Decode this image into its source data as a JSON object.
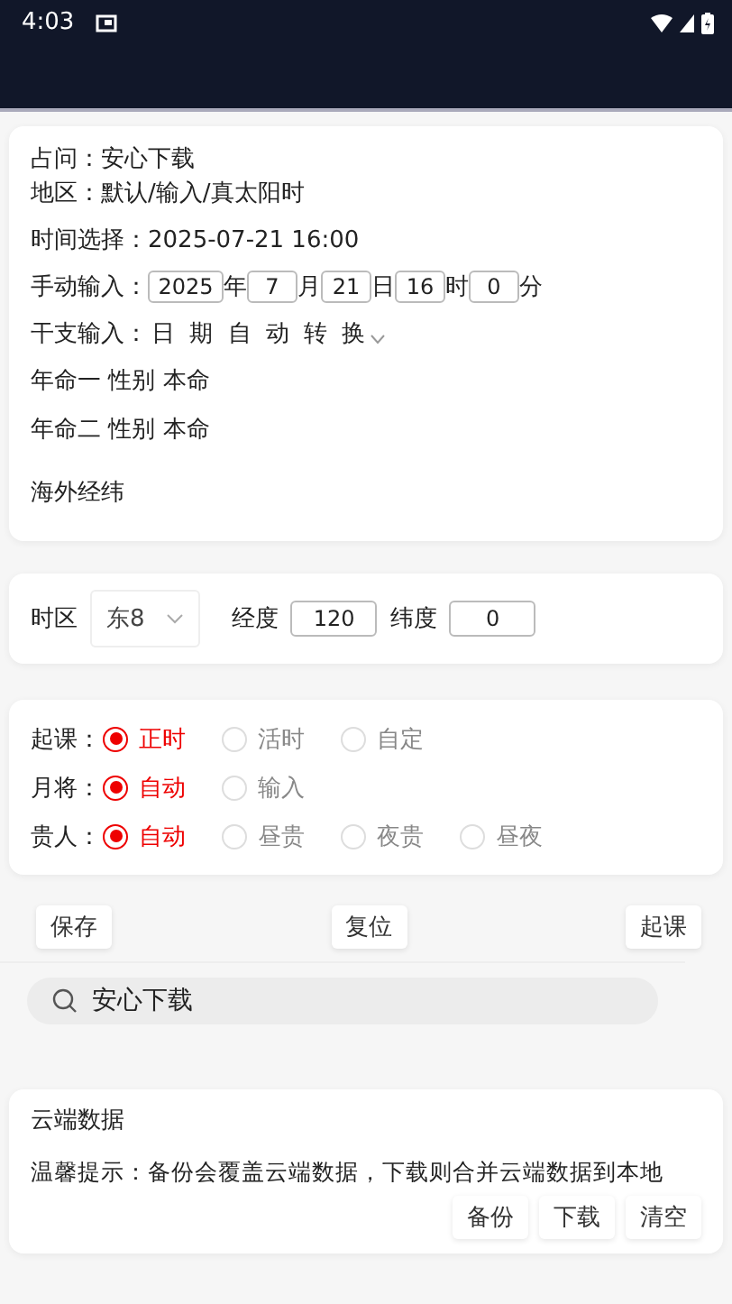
{
  "status_bar": {
    "time": "4:03"
  },
  "info": {
    "rows": [
      {
        "label": "占问：",
        "value": "安心下载"
      },
      {
        "label": "地区：",
        "value": "默认/输入/真太阳时"
      },
      {
        "label": "时间选择：",
        "value": "2025-07-21 16:00"
      }
    ],
    "manual": {
      "label": "手动输入：",
      "fields": [
        {
          "value": "2025",
          "unit": "年"
        },
        {
          "value": "7",
          "unit": "月"
        },
        {
          "value": "21",
          "unit": "日"
        },
        {
          "value": "16",
          "unit": "时"
        },
        {
          "value": "0",
          "unit": "分"
        }
      ]
    },
    "ganzhi": {
      "label": "干支输入：",
      "value": "日 期 自 动 转 换"
    },
    "extra": [
      "年命一 性别 本命",
      "年命二 性别 本命",
      "海外经纬"
    ]
  },
  "location": {
    "timezone_label": "时区",
    "timezone": "东8",
    "longitude_label": "经度",
    "longitude": "120",
    "latitude_label": "纬度",
    "latitude": "0"
  },
  "options": [
    {
      "label": "起课：",
      "choices": [
        {
          "label": "正时",
          "selected": true
        },
        {
          "label": "活时",
          "selected": false
        },
        {
          "label": "自定",
          "selected": false
        }
      ]
    },
    {
      "label": "月将：",
      "choices": [
        {
          "label": "自动",
          "selected": true
        },
        {
          "label": "输入",
          "selected": false
        }
      ]
    },
    {
      "label": "贵人：",
      "choices": [
        {
          "label": "自动",
          "selected": true
        },
        {
          "label": "昼贵",
          "selected": false
        },
        {
          "label": "夜贵",
          "selected": false
        },
        {
          "label": "昼夜",
          "selected": false
        }
      ]
    }
  ],
  "actions": [
    "保存",
    "复位",
    "起课"
  ],
  "search": {
    "value": "安心下载"
  },
  "cloud": {
    "title": "云端数据",
    "tip": "温馨提示：备份会覆盖云端数据，下载则合并云端数据到本地",
    "buttons": [
      "备份",
      "下载",
      "清空"
    ]
  }
}
